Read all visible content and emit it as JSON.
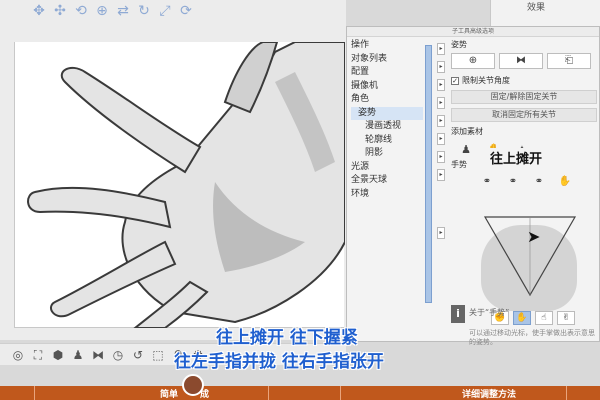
{
  "far_right": {
    "label": "效果"
  },
  "dialog": {
    "title": "子工具高级选项",
    "categories": [
      {
        "label": "操作",
        "level": 0
      },
      {
        "label": "对象列表",
        "level": 0
      },
      {
        "label": "配置",
        "level": 0
      },
      {
        "label": "摄像机",
        "level": 0
      },
      {
        "label": "角色",
        "level": 0
      },
      {
        "label": "姿势",
        "level": 1,
        "selected": true
      },
      {
        "label": "漫画透视",
        "level": 2
      },
      {
        "label": "轮廓线",
        "level": 2
      },
      {
        "label": "阴影",
        "level": 2
      },
      {
        "label": "光源",
        "level": 0
      },
      {
        "label": "全景天球",
        "level": 0
      },
      {
        "label": "环境",
        "level": 0
      }
    ],
    "settings": {
      "pose_label": "姿势",
      "limit_joint_label": "限制关节角度",
      "limit_joint_checked": true,
      "fix_joint_button": "固定/解除固定关节",
      "unfix_all_button": "取消固定所有关节",
      "add_material_label": "添加素材",
      "gesture_label": "手势"
    },
    "info": {
      "title": "关于“手势”",
      "text": "可以通过移动光标，使手掌做出表示意思的姿势。"
    }
  },
  "hints": {
    "spread_up": "往上摊开",
    "subtitle_line1": "往上摊开 往下握紧",
    "subtitle_line2": "往左手指并拢 往右手指张开"
  },
  "chapters": {
    "left_partial": "简单",
    "mid_partial": "成",
    "right": "详细调整方法"
  },
  "colors": {
    "accent_blue": "#1f5fcf",
    "bottom_bar": "#c0581c",
    "selection": "#d6e4f5"
  }
}
